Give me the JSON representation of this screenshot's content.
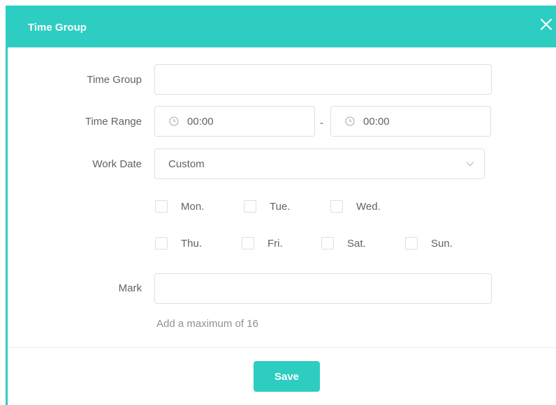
{
  "dialog": {
    "title": "Time Group",
    "close_icon": "close-icon"
  },
  "form": {
    "time_group": {
      "label": "Time Group",
      "value": "",
      "placeholder": ""
    },
    "time_range": {
      "label": "Time Range",
      "start": "00:00",
      "separator": "-",
      "end": "00:00",
      "icon": "clock-icon"
    },
    "work_date": {
      "label": "Work Date",
      "selected": "Custom",
      "icon": "chevron-down-icon",
      "days": [
        {
          "label": "Mon.",
          "checked": false
        },
        {
          "label": "Tue.",
          "checked": false
        },
        {
          "label": "Wed.",
          "checked": false
        },
        {
          "label": "Thu.",
          "checked": false
        },
        {
          "label": "Fri.",
          "checked": false
        },
        {
          "label": "Sat.",
          "checked": false
        },
        {
          "label": "Sun.",
          "checked": false
        }
      ]
    },
    "mark": {
      "label": "Mark",
      "value": "",
      "placeholder": "",
      "hint": "Add a maximum of 16"
    }
  },
  "footer": {
    "save_label": "Save"
  },
  "colors": {
    "accent": "#2ecdc1",
    "border": "#dcdfe6",
    "text": "#5f6269"
  }
}
